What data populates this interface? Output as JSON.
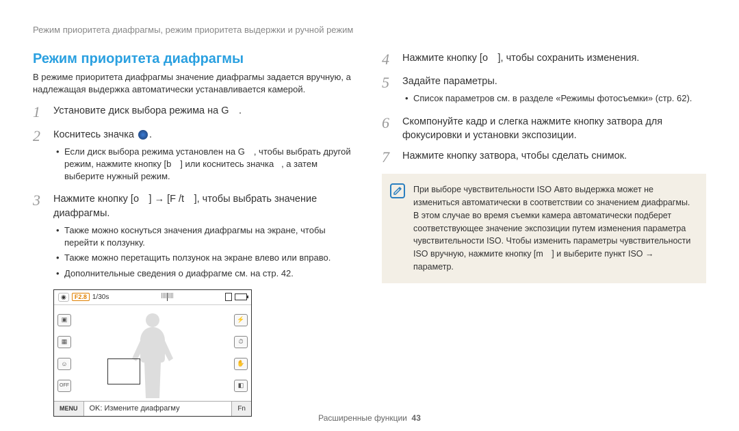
{
  "breadcrumb": "Режим приоритета диафрагмы, режим приоритета выдержки и ручной режим",
  "heading": "Режим приоритета диафрагмы",
  "intro": "В режиме приоритета диафрагмы значение диафрагмы задается вручную, а надлежащая выдержка автоматически устанавливается камерой.",
  "steps_left": [
    {
      "n": "1",
      "text": "Установите диск выбора режима на G ."
    },
    {
      "n": "2",
      "text_pre": "Коснитесь значка ",
      "text_post": ".",
      "sub": [
        "Если диск выбора режима установлен на G , чтобы выбрать другой режим, нажмите кнопку [b ] или коснитесь значка   , а затем выберите нужный режим."
      ],
      "cam_inline": true
    },
    {
      "n": "3",
      "text": "Нажмите кнопку [o ] → [F /t ], чтобы выбрать значение диафрагмы.",
      "sub": [
        "Также можно коснуться значения диафрагмы на экране, чтобы перейти к ползунку.",
        "Также можно перетащить ползунок на экране влево или вправо.",
        "Дополнительные сведения о диафрагме см. на стр. 42."
      ]
    }
  ],
  "steps_right": [
    {
      "n": "4",
      "text": "Нажмите кнопку [o ], чтобы сохранить изменения."
    },
    {
      "n": "5",
      "text": "Задайте параметры.",
      "sub": [
        "Список параметров см. в разделе «Режимы фотосъемки» (стр. 62)."
      ]
    },
    {
      "n": "6",
      "text": "Скомпонуйте кадр и слегка нажмите кнопку затвора для фокусировки и установки экспозиции."
    },
    {
      "n": "7",
      "text": "Нажмите кнопку затвора, чтобы сделать снимок."
    }
  ],
  "note": {
    "text": "При выборе чувствительности ISO Авто выдержка может не измениться автоматически в соответствии со значением диафрагмы. В этом случае во время съемки камера автоматически подберет соответствующее значение экспозиции путем изменения параметра чувствительности ISO. Чтобы изменить параметры чувствительности ISO вручную, нажмите кнопку [m ] и выберите пункт ISO → параметр.",
    "bold_terms": [
      "Авто",
      "ISO"
    ]
  },
  "lcd": {
    "f_value": "F2.8",
    "shutter": "1/30s",
    "menu": "MENU",
    "ok_text": "OK: Измените диафрагму",
    "fn": "Fn"
  },
  "footer": {
    "section": "Расширенные функции",
    "page": "43"
  }
}
